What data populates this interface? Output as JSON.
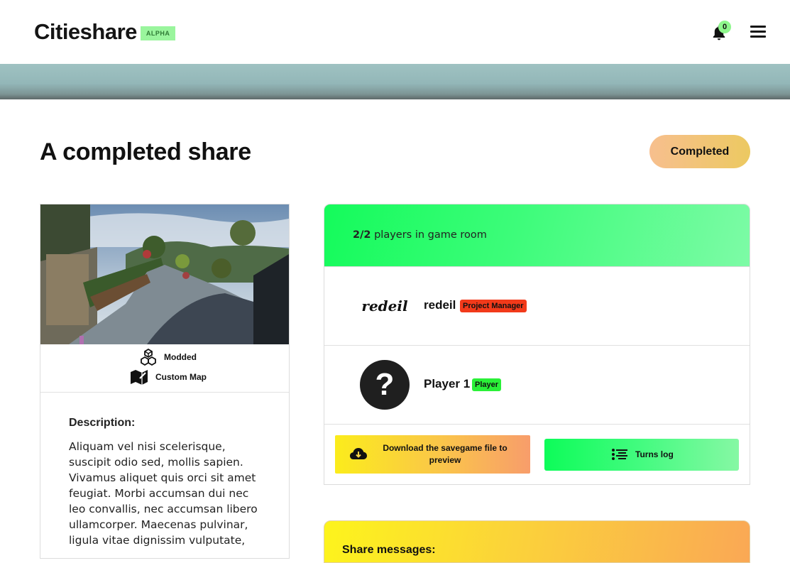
{
  "header": {
    "brand": "Citieshare",
    "badge": "ALPHA",
    "notification_count": "0"
  },
  "page": {
    "title": "A completed share",
    "status": "Completed"
  },
  "save_card": {
    "tags": [
      {
        "icon": "cubes-icon",
        "label": "Modded"
      },
      {
        "icon": "map-icon",
        "label": "Custom Map"
      }
    ],
    "description_label": "Description:",
    "description": "Aliquam vel nisi scelerisque, suscipit odio sed, mollis sapien. Vivamus aliquet quis orci sit amet feugiat. Morbi accumsan dui nec leo convallis, nec accumsan libero ullamcorper. Maecenas pulvinar, ligula vitae dignissim vulputate, "
  },
  "game_room": {
    "count": "2/2",
    "count_suffix": " players in game room",
    "players": [
      {
        "name": "redeil",
        "role": "Project Manager",
        "avatar": "redeil",
        "role_color": "#f23a1a"
      },
      {
        "name": "Player 1",
        "role": "Player",
        "avatar": "?",
        "role_color": "#2af038"
      }
    ],
    "download_label": "Download the savegame file to preview",
    "turns_label": "Turns log"
  },
  "messages": {
    "title": "Share messages:"
  }
}
